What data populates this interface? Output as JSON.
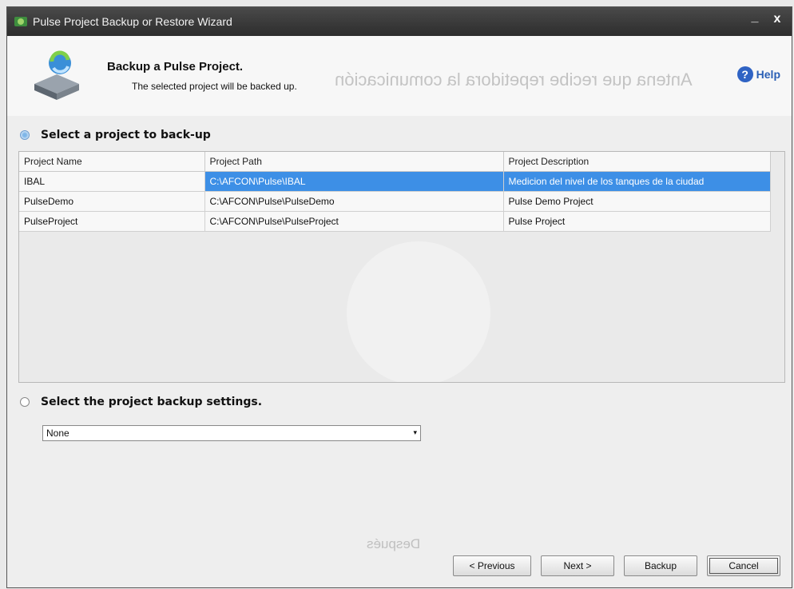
{
  "window": {
    "title": "Pulse Project Backup or Restore Wizard",
    "minimize": "_",
    "close": "x"
  },
  "header": {
    "title": "Backup a Pulse Project.",
    "subtitle": "The selected project will be backed up.",
    "help_label": "Help",
    "help_icon": "?"
  },
  "watermarks": {
    "top": "Antena que recibe repetidora la comunicación",
    "bottom": "Después"
  },
  "section1": {
    "label": "Select a project to back-up"
  },
  "table": {
    "columns": [
      "Project Name",
      "Project Path",
      "Project Description"
    ],
    "rows": [
      {
        "name": "IBAL",
        "path": "C:\\AFCON\\Pulse\\IBAL",
        "description": "Medicion del nivel de los tanques de la ciudad",
        "selected": true
      },
      {
        "name": "PulseDemo",
        "path": "C:\\AFCON\\Pulse\\PulseDemo",
        "description": "Pulse Demo Project",
        "selected": false
      },
      {
        "name": "PulseProject",
        "path": "C:\\AFCON\\Pulse\\PulseProject",
        "description": "Pulse Project",
        "selected": false
      }
    ]
  },
  "section2": {
    "label": "Select the project backup settings."
  },
  "settings_select": {
    "value": "None"
  },
  "buttons": {
    "previous": "< Previous",
    "next": "Next >",
    "backup": "Backup",
    "cancel": "Cancel"
  },
  "colors": {
    "selection": "#3d8fe6",
    "help": "#2a5fb5",
    "titlebar": "#2d2d2d"
  }
}
